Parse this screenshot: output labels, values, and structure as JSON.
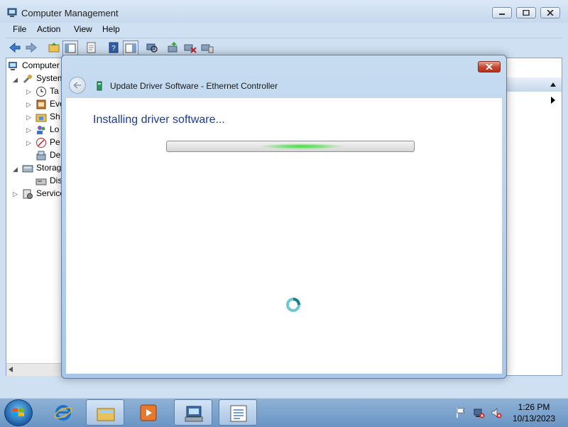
{
  "window": {
    "title": "Computer Management"
  },
  "menu": [
    "File",
    "Action",
    "View",
    "Help"
  ],
  "tree": [
    {
      "label": "Computer",
      "icon": "computer-icon"
    },
    {
      "label": "System",
      "icon": "tools-icon"
    },
    {
      "label": "Ta",
      "icon": "clock-icon"
    },
    {
      "label": "Eve",
      "icon": "event-viewer-icon"
    },
    {
      "label": "Sh",
      "icon": "shared-folders-icon"
    },
    {
      "label": "Lo",
      "icon": "users-icon"
    },
    {
      "label": "Pe",
      "icon": "performance-icon"
    },
    {
      "label": "De",
      "icon": "device-manager-icon"
    },
    {
      "label": "Storag",
      "icon": "storage-icon"
    },
    {
      "label": "Dis",
      "icon": "disk-icon"
    },
    {
      "label": "Service",
      "icon": "services-icon"
    }
  ],
  "dialog": {
    "title": "Update Driver Software - Ethernet Controller",
    "heading": "Installing driver software...",
    "progress_state": "indeterminate"
  },
  "taskbar": {
    "time": "1:26 PM",
    "date": "10/13/2023",
    "apps": [
      "internet-explorer-icon",
      "explorer-icon",
      "media-player-icon",
      "computer-management-icon",
      "notepad-icon"
    ]
  },
  "colors": {
    "accent_text": "#1e3a8a",
    "progress_glow": "#3de23a",
    "close_red": "#c4452f"
  }
}
